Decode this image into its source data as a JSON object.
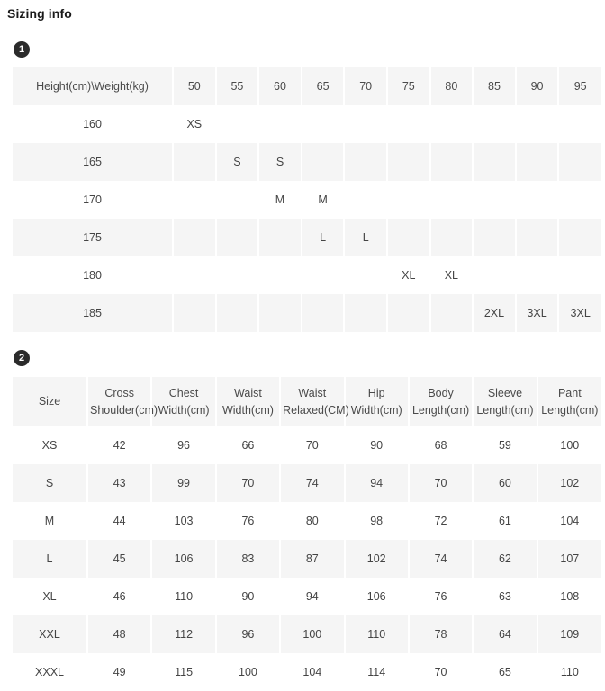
{
  "page": {
    "title": "Sizing info"
  },
  "sections": [
    {
      "badge": "1"
    },
    {
      "badge": "2"
    }
  ],
  "size_grid": {
    "corner_label": "Height(cm)\\Weight(kg)",
    "weights": [
      "50",
      "55",
      "60",
      "65",
      "70",
      "75",
      "80",
      "85",
      "90",
      "95"
    ],
    "rows": [
      {
        "height": "160",
        "cells": [
          "XS",
          "",
          "",
          "",
          "",
          "",
          "",
          "",
          "",
          ""
        ]
      },
      {
        "height": "165",
        "cells": [
          "",
          "S",
          "S",
          "",
          "",
          "",
          "",
          "",
          "",
          ""
        ]
      },
      {
        "height": "170",
        "cells": [
          "",
          "",
          "M",
          "M",
          "",
          "",
          "",
          "",
          "",
          ""
        ]
      },
      {
        "height": "175",
        "cells": [
          "",
          "",
          "",
          "L",
          "L",
          "",
          "",
          "",
          "",
          ""
        ]
      },
      {
        "height": "180",
        "cells": [
          "",
          "",
          "",
          "",
          "",
          "XL",
          "XL",
          "",
          "",
          ""
        ]
      },
      {
        "height": "185",
        "cells": [
          "",
          "",
          "",
          "",
          "",
          "",
          "",
          "2XL",
          "3XL",
          "3XL"
        ]
      }
    ]
  },
  "measurements": {
    "columns": [
      "Size",
      "Cross Shoulder(cm)",
      "Chest Width(cm)",
      "Waist Width(cm)",
      "Waist Relaxed(CM)",
      "Hip Width(cm)",
      "Body Length(cm)",
      "Sleeve Length(cm)",
      "Pant Length(cm)"
    ],
    "rows": [
      {
        "size": "XS",
        "values": [
          "42",
          "96",
          "66",
          "70",
          "90",
          "68",
          "59",
          "100"
        ]
      },
      {
        "size": "S",
        "values": [
          "43",
          "99",
          "70",
          "74",
          "94",
          "70",
          "60",
          "102"
        ]
      },
      {
        "size": "M",
        "values": [
          "44",
          "103",
          "76",
          "80",
          "98",
          "72",
          "61",
          "104"
        ]
      },
      {
        "size": "L",
        "values": [
          "45",
          "106",
          "83",
          "87",
          "102",
          "74",
          "62",
          "107"
        ]
      },
      {
        "size": "XL",
        "values": [
          "46",
          "110",
          "90",
          "94",
          "106",
          "76",
          "63",
          "108"
        ]
      },
      {
        "size": "XXL",
        "values": [
          "48",
          "112",
          "96",
          "100",
          "110",
          "78",
          "64",
          "109"
        ]
      },
      {
        "size": "XXXL",
        "values": [
          "49",
          "115",
          "100",
          "104",
          "114",
          "70",
          "65",
          "110"
        ]
      }
    ]
  },
  "colors": {
    "stripe": "#f5f5f5",
    "badge": "#2b2b2b",
    "text": "#444444",
    "title": "#1a1a1a"
  }
}
